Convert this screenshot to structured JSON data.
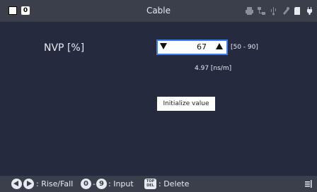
{
  "titlebar": {
    "title": "Cable",
    "badge": "0",
    "icons": [
      "printer-icon",
      "network-icon",
      "usb-icon",
      "settings-icon",
      "sd-card-icon",
      "power-plug-icon"
    ]
  },
  "nvp": {
    "label": "NVP [%]",
    "value": "67",
    "range": "[50 - 90]",
    "ns_per_m": "4.97 [ns/m]"
  },
  "actions": {
    "initialize_label": "Initialize value"
  },
  "footer": {
    "rise_fall_label": ": Rise/Fall",
    "key_zero": "0",
    "dash": "-",
    "key_nine": "9",
    "input_label": ": Input",
    "top_text": "TOP",
    "del_text": "DEL",
    "delete_label": ": Delete"
  },
  "colors": {
    "background": "#252a3f",
    "bar": "#3b3f4c",
    "accent": "#3a7ef5"
  }
}
